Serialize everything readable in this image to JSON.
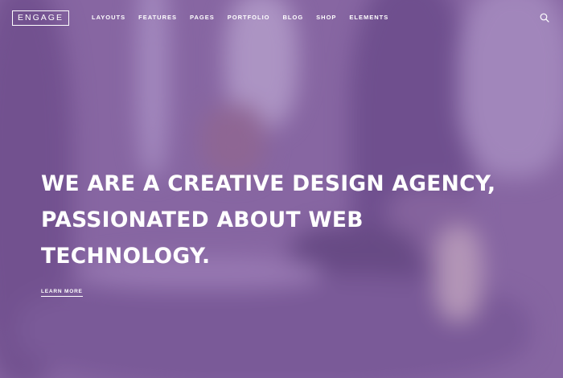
{
  "nav": {
    "logo": "ENGAGE",
    "items": [
      {
        "label": "LAYOUTS"
      },
      {
        "label": "FEATURES"
      },
      {
        "label": "PAGES"
      },
      {
        "label": "PORTFOLIO"
      },
      {
        "label": "BLOG"
      },
      {
        "label": "SHOP"
      },
      {
        "label": "ELEMENTS"
      }
    ],
    "search_icon": "search-icon"
  },
  "hero": {
    "headline_lines": [
      "WE ARE A CREATIVE DESIGN AGENCY,",
      "PASSIONATED ABOUT WEB",
      "TECHNOLOGY."
    ],
    "cta_label": "LEARN MORE"
  },
  "colors": {
    "overlay": "#7856a0",
    "text": "#ffffff"
  }
}
